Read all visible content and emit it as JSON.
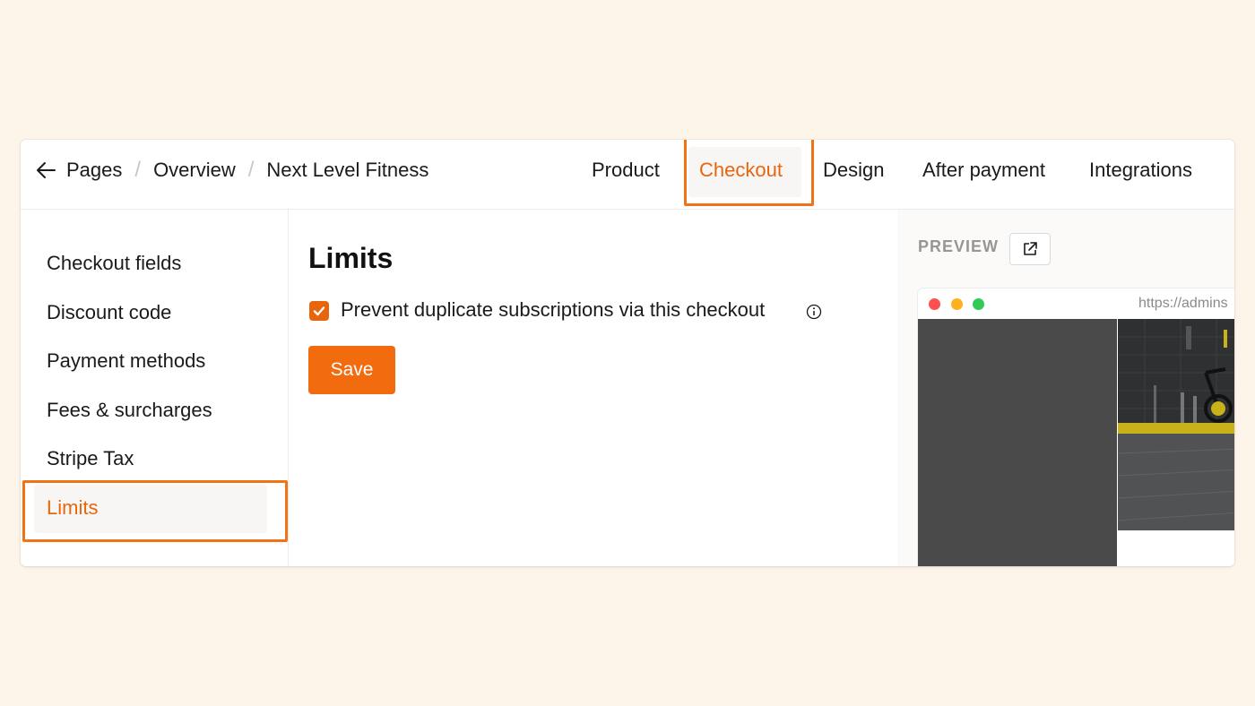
{
  "header": {
    "breadcrumb": [
      "Pages",
      "Overview",
      "Next Level Fitness"
    ],
    "separator": "/",
    "tabs": [
      {
        "label": "Product",
        "active": false
      },
      {
        "label": "Checkout",
        "active": true
      },
      {
        "label": "Design",
        "active": false
      },
      {
        "label": "After payment",
        "active": false
      },
      {
        "label": "Integrations",
        "active": false
      }
    ]
  },
  "sidebar": {
    "items": [
      {
        "label": "Checkout fields",
        "active": false
      },
      {
        "label": "Discount code",
        "active": false
      },
      {
        "label": "Payment methods",
        "active": false
      },
      {
        "label": "Fees & surcharges",
        "active": false
      },
      {
        "label": "Stripe Tax",
        "active": false
      },
      {
        "label": "Limits",
        "active": true
      }
    ]
  },
  "main": {
    "title": "Limits",
    "checkbox_label": "Prevent duplicate subscriptions via this checkout",
    "checkbox_checked": true,
    "save_label": "Save"
  },
  "preview": {
    "label": "PREVIEW",
    "url": "https://admins",
    "icons": [
      "external-link-icon"
    ]
  },
  "colors": {
    "accent": "#e8650d",
    "button": "#f26b0f",
    "highlight": "#f07416",
    "background": "#fdf4ea",
    "dot_red": "#ff4f4f",
    "dot_yellow": "#ffb020",
    "dot_green": "#2ecc55"
  }
}
